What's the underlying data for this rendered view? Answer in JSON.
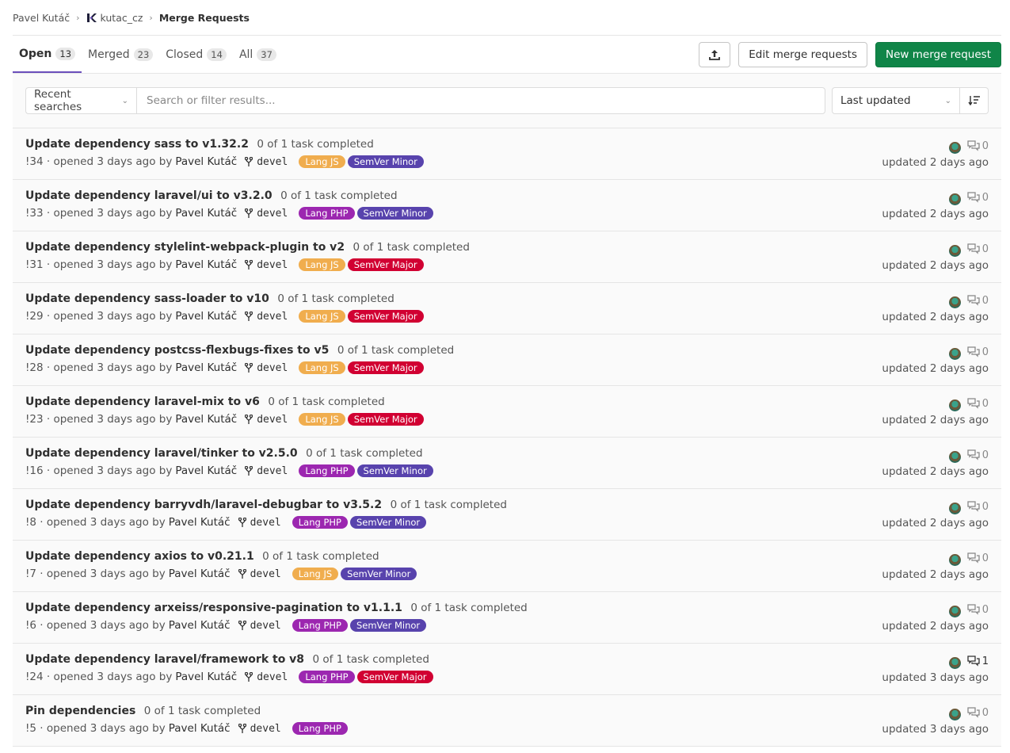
{
  "breadcrumb": {
    "user": "Pavel Kutáč",
    "project": "kutac_cz",
    "current": "Merge Requests"
  },
  "tabs": [
    {
      "label": "Open",
      "count": "13",
      "active": true
    },
    {
      "label": "Merged",
      "count": "23",
      "active": false
    },
    {
      "label": "Closed",
      "count": "14",
      "active": false
    },
    {
      "label": "All",
      "count": "37",
      "active": false
    }
  ],
  "actions": {
    "export_icon": "upload-icon",
    "edit_label": "Edit merge requests",
    "new_label": "New merge request"
  },
  "filter": {
    "recent_label": "Recent searches",
    "search_placeholder": "Search or filter results...",
    "sort_label": "Last updated",
    "sort_dir_icon": "sort-lowest-icon"
  },
  "colors": {
    "accent": "#6b4fbb",
    "green": "#108548",
    "lang_js": "#f0ad4e",
    "lang_php": "#9c27b0",
    "semver_minor": "#5843ad",
    "semver_major": "#d10032"
  },
  "merge_requests": [
    {
      "title": "Update dependency sass to v1.32.2",
      "tasks": "0 of 1 task completed",
      "meta": "!34 · opened 3 days ago by",
      "author": "Pavel Kutáč",
      "branch": "devel",
      "labels": [
        {
          "text": "Lang JS",
          "color": "#f0ad4e"
        },
        {
          "text": "SemVer Minor",
          "color": "#5843ad"
        }
      ],
      "comments": "0",
      "updated": "updated 2 days ago"
    },
    {
      "title": "Update dependency laravel/ui to v3.2.0",
      "tasks": "0 of 1 task completed",
      "meta": "!33 · opened 3 days ago by",
      "author": "Pavel Kutáč",
      "branch": "devel",
      "labels": [
        {
          "text": "Lang PHP",
          "color": "#9c27b0"
        },
        {
          "text": "SemVer Minor",
          "color": "#5843ad"
        }
      ],
      "comments": "0",
      "updated": "updated 2 days ago"
    },
    {
      "title": "Update dependency stylelint-webpack-plugin to v2",
      "tasks": "0 of 1 task completed",
      "meta": "!31 · opened 3 days ago by",
      "author": "Pavel Kutáč",
      "branch": "devel",
      "labels": [
        {
          "text": "Lang JS",
          "color": "#f0ad4e"
        },
        {
          "text": "SemVer Major",
          "color": "#d10032"
        }
      ],
      "comments": "0",
      "updated": "updated 2 days ago"
    },
    {
      "title": "Update dependency sass-loader to v10",
      "tasks": "0 of 1 task completed",
      "meta": "!29 · opened 3 days ago by",
      "author": "Pavel Kutáč",
      "branch": "devel",
      "labels": [
        {
          "text": "Lang JS",
          "color": "#f0ad4e"
        },
        {
          "text": "SemVer Major",
          "color": "#d10032"
        }
      ],
      "comments": "0",
      "updated": "updated 2 days ago"
    },
    {
      "title": "Update dependency postcss-flexbugs-fixes to v5",
      "tasks": "0 of 1 task completed",
      "meta": "!28 · opened 3 days ago by",
      "author": "Pavel Kutáč",
      "branch": "devel",
      "labels": [
        {
          "text": "Lang JS",
          "color": "#f0ad4e"
        },
        {
          "text": "SemVer Major",
          "color": "#d10032"
        }
      ],
      "comments": "0",
      "updated": "updated 2 days ago"
    },
    {
      "title": "Update dependency laravel-mix to v6",
      "tasks": "0 of 1 task completed",
      "meta": "!23 · opened 3 days ago by",
      "author": "Pavel Kutáč",
      "branch": "devel",
      "labels": [
        {
          "text": "Lang JS",
          "color": "#f0ad4e"
        },
        {
          "text": "SemVer Major",
          "color": "#d10032"
        }
      ],
      "comments": "0",
      "updated": "updated 2 days ago"
    },
    {
      "title": "Update dependency laravel/tinker to v2.5.0",
      "tasks": "0 of 1 task completed",
      "meta": "!16 · opened 3 days ago by",
      "author": "Pavel Kutáč",
      "branch": "devel",
      "labels": [
        {
          "text": "Lang PHP",
          "color": "#9c27b0"
        },
        {
          "text": "SemVer Minor",
          "color": "#5843ad"
        }
      ],
      "comments": "0",
      "updated": "updated 2 days ago"
    },
    {
      "title": "Update dependency barryvdh/laravel-debugbar to v3.5.2",
      "tasks": "0 of 1 task completed",
      "meta": "!8 · opened 3 days ago by",
      "author": "Pavel Kutáč",
      "branch": "devel",
      "labels": [
        {
          "text": "Lang PHP",
          "color": "#9c27b0"
        },
        {
          "text": "SemVer Minor",
          "color": "#5843ad"
        }
      ],
      "comments": "0",
      "updated": "updated 2 days ago"
    },
    {
      "title": "Update dependency axios to v0.21.1",
      "tasks": "0 of 1 task completed",
      "meta": "!7 · opened 3 days ago by",
      "author": "Pavel Kutáč",
      "branch": "devel",
      "labels": [
        {
          "text": "Lang JS",
          "color": "#f0ad4e"
        },
        {
          "text": "SemVer Minor",
          "color": "#5843ad"
        }
      ],
      "comments": "0",
      "updated": "updated 2 days ago"
    },
    {
      "title": "Update dependency arxeiss/responsive-pagination to v1.1.1",
      "tasks": "0 of 1 task completed",
      "meta": "!6 · opened 3 days ago by",
      "author": "Pavel Kutáč",
      "branch": "devel",
      "labels": [
        {
          "text": "Lang PHP",
          "color": "#9c27b0"
        },
        {
          "text": "SemVer Minor",
          "color": "#5843ad"
        }
      ],
      "comments": "0",
      "updated": "updated 2 days ago"
    },
    {
      "title": "Update dependency laravel/framework to v8",
      "tasks": "0 of 1 task completed",
      "meta": "!24 · opened 3 days ago by",
      "author": "Pavel Kutáč",
      "branch": "devel",
      "labels": [
        {
          "text": "Lang PHP",
          "color": "#9c27b0"
        },
        {
          "text": "SemVer Major",
          "color": "#d10032"
        }
      ],
      "comments": "1",
      "updated": "updated 3 days ago"
    },
    {
      "title": "Pin dependencies",
      "tasks": "0 of 1 task completed",
      "meta": "!5 · opened 3 days ago by",
      "author": "Pavel Kutáč",
      "branch": "devel",
      "labels": [
        {
          "text": "Lang PHP",
          "color": "#9c27b0"
        }
      ],
      "comments": "0",
      "updated": "updated 3 days ago"
    }
  ]
}
